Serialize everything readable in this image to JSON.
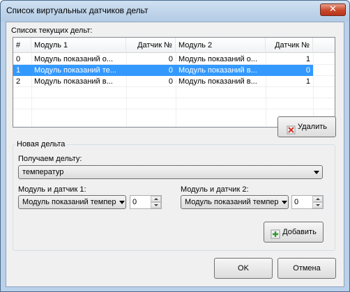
{
  "window": {
    "title": "Список виртуальных датчиков дельт",
    "close_glyph": "✕"
  },
  "list": {
    "label": "Список текущих дельт:",
    "columns": [
      "#",
      "Модуль 1",
      "Датчик №",
      "Модуль 2",
      "Датчик №"
    ],
    "rows": [
      {
        "index": "0",
        "module1": "Модуль показаний о...",
        "sensor1": "0",
        "module2": "Модуль показаний о...",
        "sensor2": "1",
        "selected": false
      },
      {
        "index": "1",
        "module1": "Модуль показаний те...",
        "sensor1": "0",
        "module2": "Модуль показаний в...",
        "sensor2": "0",
        "selected": true
      },
      {
        "index": "2",
        "module1": "Модуль показаний в...",
        "sensor1": "0",
        "module2": "Модуль показаний в...",
        "sensor2": "1",
        "selected": false
      }
    ]
  },
  "buttons": {
    "delete": "Удалить",
    "add": "Добавить",
    "ok": "OK",
    "cancel": "Отмена"
  },
  "new_delta": {
    "group_title": "Новая дельта",
    "get_delta_label": "Получаем дельту:",
    "delta_type_value": "температур",
    "module1_label": "Модуль и датчик 1:",
    "module1_value": "Модуль показаний темпер",
    "sensor1_value": "0",
    "module2_label": "Модуль и датчик 2:",
    "module2_value": "Модуль показаний темпер",
    "sensor2_value": "0"
  },
  "colors": {
    "selection": "#3399ff",
    "window_frame": "#b9d1ea",
    "close_button": "#c7482a"
  },
  "icons": {
    "delete": "delete-x-icon",
    "add": "add-plus-icon"
  }
}
